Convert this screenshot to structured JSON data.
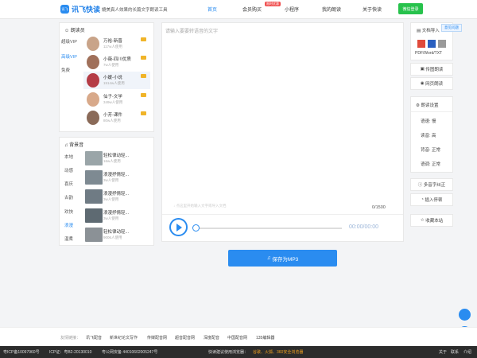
{
  "header": {
    "logo_badge": "讯飞",
    "brand": "讯飞快读",
    "slogan": "媲美真人效果的长篇文字朗读工具",
    "nav": [
      "首页",
      "会员购买",
      "小程序",
      "我的朗读",
      "关于快读"
    ],
    "hot_badge": "限时优惠",
    "login": "微信登录"
  },
  "readers": {
    "title": "朗读员",
    "tabs": [
      "超级VIP",
      "高级VIP",
      "免费"
    ],
    "items": [
      {
        "name": "万裕-新晋",
        "count": "117w人使用"
      },
      {
        "name": "小薇-四川优质",
        "count": "7w人使用"
      },
      {
        "name": "小媛-小说",
        "count": "1514w人使用"
      },
      {
        "name": "仙子-文学",
        "count": "349w人使用"
      },
      {
        "name": "小芳-课件",
        "count": "80w人使用"
      }
    ]
  },
  "bgm": {
    "title": "背景音",
    "tabs": [
      "本地",
      "动感",
      "喜庆",
      "古韵",
      "欢快",
      "浪漫",
      "温柔",
      "温馨"
    ],
    "items": [
      {
        "name": "轻松律动轻...",
        "count": "16w人使用"
      },
      {
        "name": "浪漫抒情轻...",
        "count": "3w人使用"
      },
      {
        "name": "浪漫抒情轻...",
        "count": "3w人使用"
      },
      {
        "name": "浪漫抒情轻...",
        "count": "3w人使用"
      },
      {
        "name": "轻松律动轻...",
        "count": "9006人使用"
      }
    ]
  },
  "editor": {
    "placeholder": "请输入要要转语音的文字",
    "hint": "↓ 点这里开始输入文字或导入文档",
    "word_count": "0/1500",
    "time": "00:00/00:00"
  },
  "save_button": "保存为MP3",
  "right": {
    "doc_import": "文档导入",
    "formats": "PDF/Word/TXT",
    "image_read": "传图朗读",
    "web_read": "网页朗读",
    "settings_title": "朗读设置",
    "settings": [
      "语速: 慢",
      "读音: 高",
      "背音: 正常",
      "语调: 正常"
    ],
    "polyphone": "多音字纠正",
    "pause": "插入停顿",
    "favorites": "收藏本站",
    "feedback": "意见问题"
  },
  "footer": {
    "links_label": "友情链接：",
    "links": [
      "讯飞配音",
      "新世纪论文写作",
      "传媒配音网",
      "超音配音网",
      "深度配音",
      "中国配音网",
      "135编辑器"
    ],
    "icp": "粤ICP备10097960号",
    "license": "ICP证：粤B2-20130010",
    "police": "粤公网安备 44010602005247号",
    "browser_tip": "快读建议使用浏览器：",
    "browsers": "谷歌、火狐、360安全浏览器",
    "about": "关于",
    "contact": "联系",
    "intro": "介绍"
  },
  "colors": {
    "accent": "#2a8cf0",
    "login": "#27c24c",
    "footer_bg": "#2c2c2c"
  }
}
